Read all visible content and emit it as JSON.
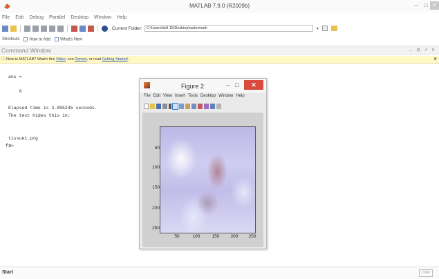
{
  "window": {
    "title": "MATLAB 7.9.0 (R2009b)",
    "min": "–",
    "max": "□",
    "close": "✕"
  },
  "menu": [
    "File",
    "Edit",
    "Debug",
    "Parallel",
    "Desktop",
    "Window",
    "Help"
  ],
  "toolbar": {
    "current_folder_label": "Current Folder:",
    "current_folder_value": "C:\\Users\\dell 15\\Desktop\\watermark",
    "dropdown": "▾",
    "dots": "..."
  },
  "shortcuts": {
    "label": "Shortcuts",
    "items": [
      "How to Add",
      "What's New"
    ]
  },
  "command_window": {
    "title": "Command Window",
    "controls": "→ ⊟ ↗ ✕",
    "info_prefix": "New to MATLAB? Watch this ",
    "info_video": "Video",
    "info_mid": ", see ",
    "info_demos": "Demos",
    "info_mid2": ", or read ",
    "info_getting_started": "Getting Started",
    "info_suffix": ".",
    "info_close": "✕",
    "lines": [
      "ans =",
      "    0",
      "Elapsed time is 3.895245 seconds.",
      "The text hides this in:",
      "tissue1.png",
      ">>"
    ],
    "marker": "fx"
  },
  "statusbar": {
    "start": "Start",
    "ovr": "OVR"
  },
  "figure": {
    "title": "Figure 2",
    "min": "–",
    "max": "□",
    "close": "✕",
    "menu": [
      "File",
      "Edit",
      "View",
      "Insert",
      "Tools",
      "Desktop",
      "Window",
      "Help"
    ],
    "yticks": [
      "50",
      "100",
      "150",
      "200",
      "250"
    ],
    "xticks": [
      "50",
      "100",
      "150",
      "200",
      "250"
    ]
  },
  "colors": {
    "close_red": "#d84a3b",
    "info_bar": "#fff8c4",
    "link_blue": "#1d4fb8"
  }
}
